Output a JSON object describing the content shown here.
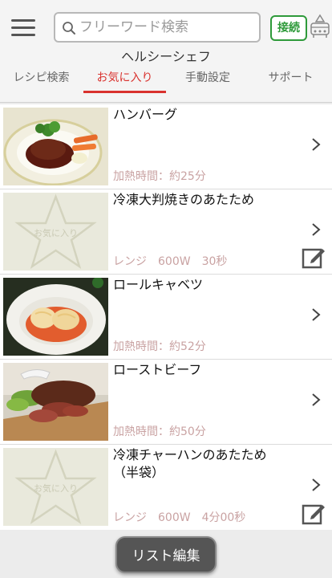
{
  "header": {
    "search_placeholder": "フリーワード検索",
    "connect_label": "接続",
    "app_title": "ヘルシーシェフ"
  },
  "tabs": [
    {
      "label": "レシピ検索",
      "active": false
    },
    {
      "label": "お気に入り",
      "active": true
    },
    {
      "label": "手動設定",
      "active": false
    },
    {
      "label": "サポート",
      "active": false
    }
  ],
  "recipes": [
    {
      "title": "ハンバーグ",
      "meta": "加熱時間：約25分",
      "image": "hamburg"
    },
    {
      "title": "冷凍大判焼きのあたため",
      "meta": "レンジ　600W　30秒",
      "image": "placeholder",
      "placeholder_text": "お気に入り",
      "editable": true
    },
    {
      "title": "ロールキャベツ",
      "meta": "加熱時間：約52分",
      "image": "rollcabbage"
    },
    {
      "title": "ローストビーフ",
      "meta": "加熱時間：約50分",
      "image": "roastbeef"
    },
    {
      "title": "冷凍チャーハンのあたため\n（半袋）",
      "meta": "レンジ　600W　4分00秒",
      "image": "placeholder",
      "placeholder_text": "お気に入り",
      "editable": true
    }
  ],
  "bottom": {
    "list_edit_label": "リスト編集"
  },
  "colors": {
    "accent": "#d9322e",
    "connect": "#2e9a3a",
    "meta_text": "#c9a2a2"
  }
}
